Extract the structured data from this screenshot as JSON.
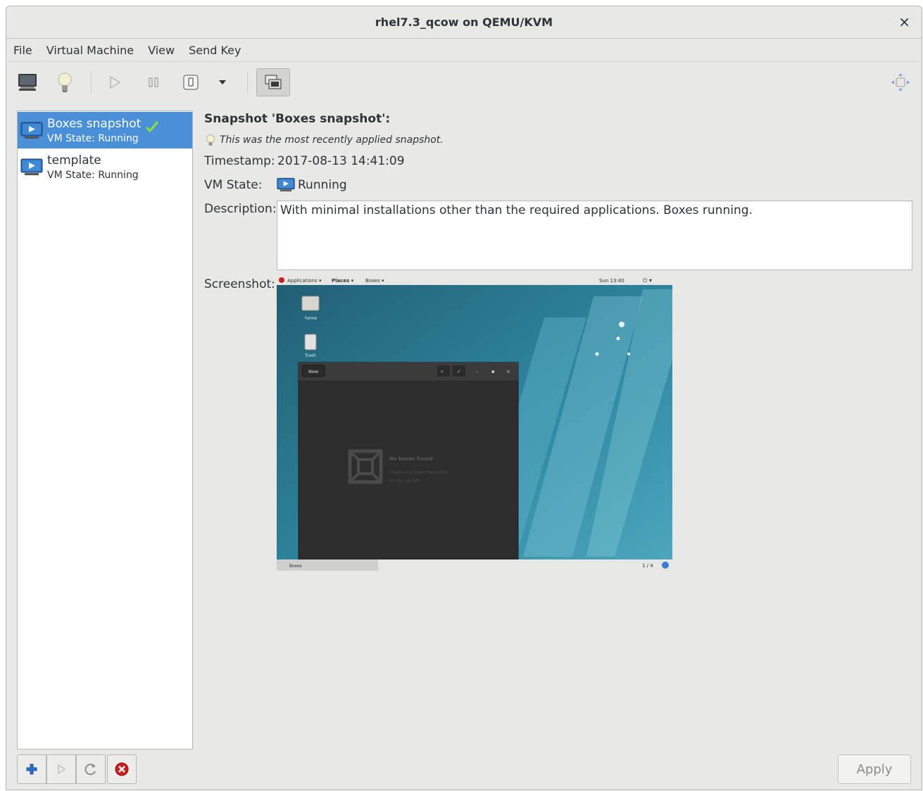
{
  "window": {
    "title": "rhel7.3_qcow on QEMU/KVM",
    "close_glyph": "×"
  },
  "menu": [
    "File",
    "Virtual Machine",
    "View",
    "Send Key"
  ],
  "toolbar": {
    "icons": [
      "monitor-icon",
      "lightbulb-icon",
      "play-icon",
      "pause-icon",
      "power-icon",
      "dropdown-arrow-icon",
      "snapshots-icon",
      "fullscreen-move-icon"
    ]
  },
  "snapshots": [
    {
      "name": "Boxes snapshot",
      "state": "VM State: Running",
      "selected": true,
      "current": true
    },
    {
      "name": "template",
      "state": "VM State: Running",
      "selected": false,
      "current": false
    }
  ],
  "detail": {
    "header": "Snapshot 'Boxes snapshot':",
    "note": "This was the most recently applied snapshot.",
    "timestamp_label": "Timestamp:",
    "timestamp": "2017-08-13 14:41:09",
    "vmstate_label": "VM State:",
    "vmstate": "Running",
    "description_label": "Description:",
    "description": "With minimal installations other than the required applications. Boxes running.",
    "screenshot_label": "Screenshot:"
  },
  "guest_screenshot": {
    "topbar_apps": "Applications ▾",
    "topbar_places": "Places ▾",
    "topbar_boxes": "Boxes ▾",
    "clock": "Sun 13:40",
    "desktop_home": "home",
    "desktop_trash": "Trash",
    "boxes_new": "New",
    "empty_title": "No boxes found",
    "empty_sub1": "Create one using the button",
    "empty_sub2": "on the top left.",
    "taskbar_item": "Boxes",
    "workspace": "1 / 4"
  },
  "apply_label": "Apply",
  "colors": {
    "selection": "#4a90d9",
    "window_bg": "#e8e8e7",
    "accent_red": "#cc1f1f",
    "accent_blue": "#2a6fd0"
  }
}
